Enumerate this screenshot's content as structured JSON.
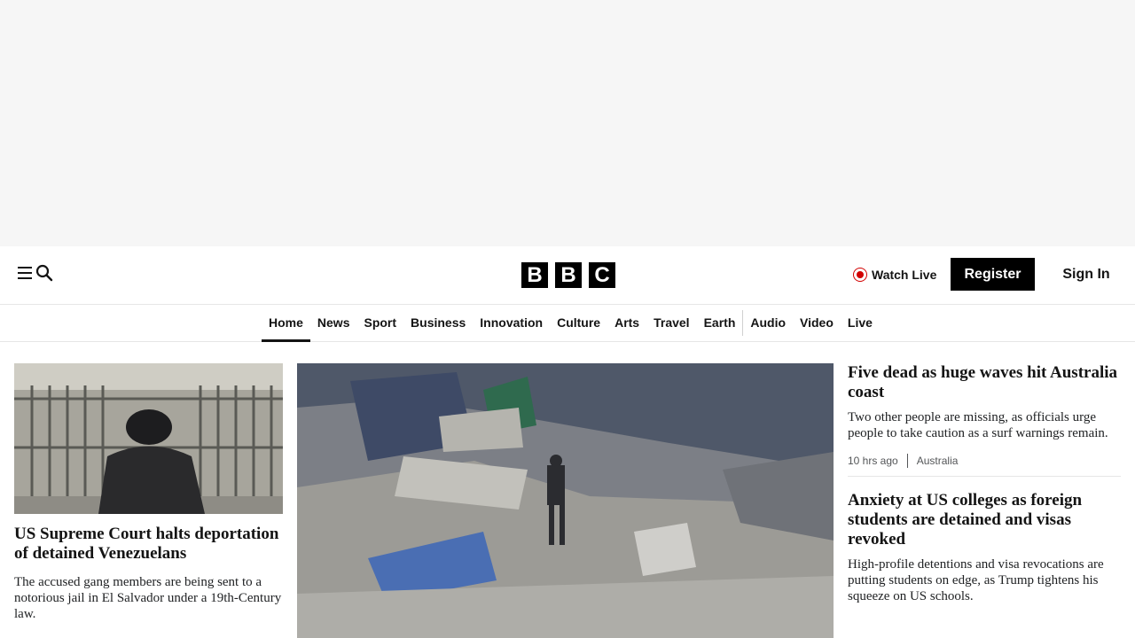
{
  "brand": {
    "logo_letters": [
      "B",
      "B",
      "C"
    ]
  },
  "header": {
    "menu_icon": "hamburger-menu-icon",
    "search_icon": "search-icon",
    "watch_live_label": "Watch Live",
    "register_label": "Register",
    "signin_label": "Sign In",
    "live_color": "#d20000"
  },
  "nav": {
    "items": [
      "Home",
      "News",
      "Sport",
      "Business",
      "Innovation",
      "Culture",
      "Arts",
      "Travel",
      "Earth",
      "Audio",
      "Video",
      "Live"
    ],
    "active": "Home"
  },
  "stories": {
    "left": {
      "headline": "US Supreme Court halts deportation of detained Venezuelans",
      "summary": "The accused gang members are being sent to a notorious jail in El Salvador under a 19th-Century law."
    },
    "right": [
      {
        "headline": "Five dead as huge waves hit Australia coast",
        "summary": "Two other people are missing, as officials urge people to take caution as a surf warnings remain.",
        "time": "10 hrs ago",
        "tag": "Australia"
      },
      {
        "headline": "Anxiety at US colleges as foreign students are detained and visas revoked",
        "summary": "High-profile detentions and visa revocations are putting students on edge, as Trump tightens his squeeze on US schools."
      }
    ]
  }
}
